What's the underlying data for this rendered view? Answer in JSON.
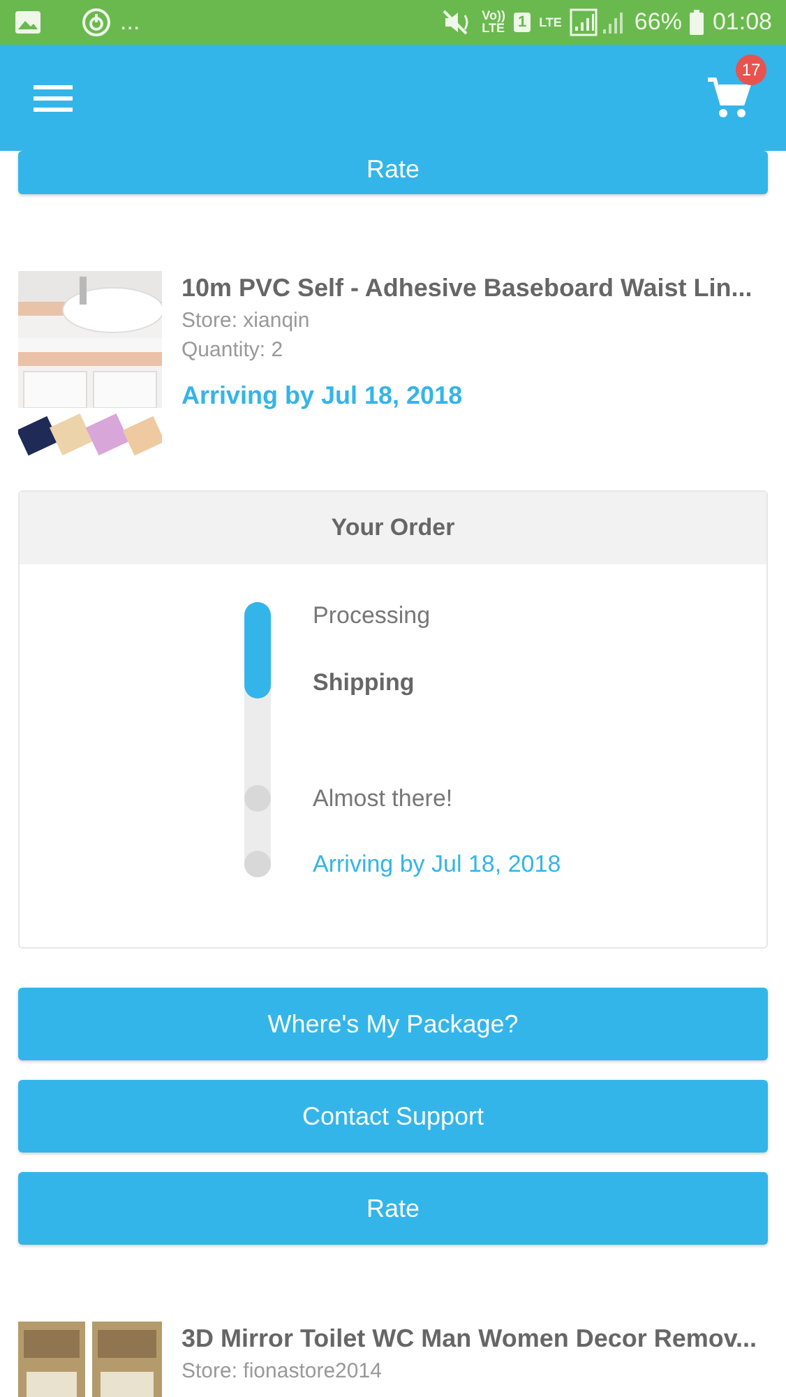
{
  "status_bar": {
    "notification_more": "...",
    "volte": "Vo))",
    "volte_sub": "LTE",
    "sim": "1",
    "network": "LTE",
    "battery": "66%",
    "time": "01:08"
  },
  "header": {
    "cart_count": "17"
  },
  "top_button": {
    "label": "Rate"
  },
  "product": {
    "title": "10m PVC Self - Adhesive Baseboard Waist Lin...",
    "store": "Store: xianqin",
    "quantity": "Quantity: 2",
    "arrival": "Arriving by Jul 18, 2018"
  },
  "order": {
    "title": "Your Order",
    "level": 0.35,
    "steps": [
      {
        "label": "Processing",
        "kind": "done",
        "selected": false
      },
      {
        "label": "Shipping",
        "kind": "done",
        "selected": true
      },
      {
        "label": "Almost there!",
        "kind": "pending",
        "selected": false
      },
      {
        "label": "Arriving by Jul 18, 2018",
        "kind": "eta",
        "selected": false
      }
    ]
  },
  "buttons": [
    "Where's My Package?",
    "Contact Support",
    "Rate"
  ],
  "next_product": {
    "title": "3D Mirror Toilet WC Man Women Decor Remov...",
    "store": "Store: fionastore2014"
  }
}
